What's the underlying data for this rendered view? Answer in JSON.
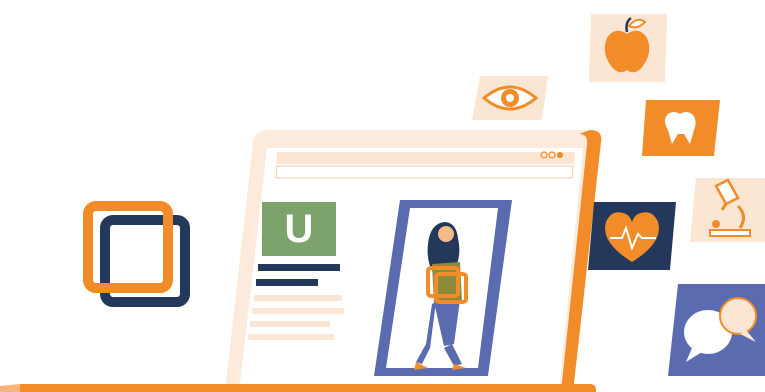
{
  "browser": {
    "address_bar_text": "",
    "window_controls": [
      "circle-outline",
      "circle-outline",
      "circle-filled"
    ]
  },
  "document": {
    "logo_letter": "U"
  },
  "icons": [
    {
      "name": "apple-icon"
    },
    {
      "name": "eye-icon"
    },
    {
      "name": "tooth-icon"
    },
    {
      "name": "heart-rate-icon"
    },
    {
      "name": "microscope-icon"
    },
    {
      "name": "chat-bubbles-icon"
    },
    {
      "name": "window-stack-icon"
    }
  ],
  "colors": {
    "orange": "#F28C28",
    "peach": "#FBE6D3",
    "navy": "#23385A",
    "indigo": "#5B6BB0",
    "green": "#7CA36B",
    "light_orange": "#FCEBDD"
  }
}
